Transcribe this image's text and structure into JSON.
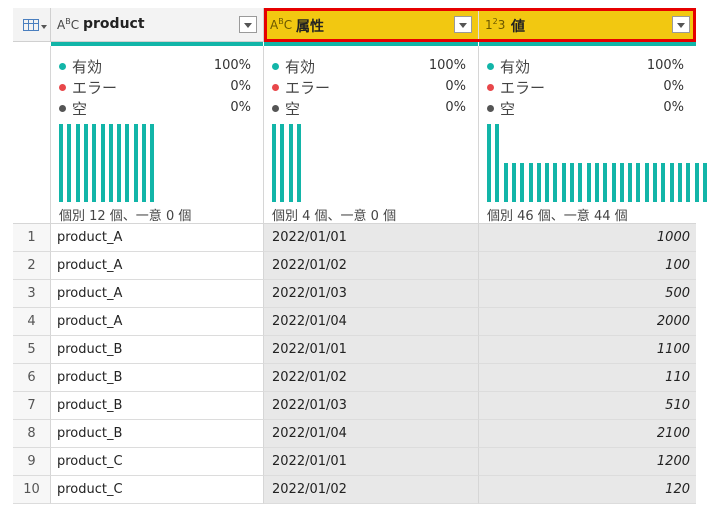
{
  "columns": [
    {
      "type_icon": "ABC",
      "name": "product",
      "selected": false
    },
    {
      "type_icon": "ABC",
      "name": "属性",
      "selected": true
    },
    {
      "type_icon": "123",
      "name": "値",
      "selected": true
    }
  ],
  "profile": [
    {
      "valid_label": "有効",
      "valid_pct": "100%",
      "error_label": "エラー",
      "error_pct": "0%",
      "empty_label": "空",
      "empty_pct": "0%",
      "distinct": "個別 12 個、一意 0 個",
      "distribution": [
        1,
        1,
        1,
        1,
        1,
        1,
        1,
        1,
        1,
        1,
        1,
        1
      ]
    },
    {
      "valid_label": "有効",
      "valid_pct": "100%",
      "error_label": "エラー",
      "error_pct": "0%",
      "empty_label": "空",
      "empty_pct": "0%",
      "distinct": "個別 4 個、一意 0 個",
      "distribution": [
        1,
        1,
        1,
        1
      ]
    },
    {
      "valid_label": "有効",
      "valid_pct": "100%",
      "error_label": "エラー",
      "error_pct": "0%",
      "empty_label": "空",
      "empty_pct": "0%",
      "distinct": "個別 46 個、一意 44 個",
      "distribution": [
        1,
        1,
        0.5,
        0.5,
        0.5,
        0.5,
        0.5,
        0.5,
        0.5,
        0.5,
        0.5,
        0.5,
        0.5,
        0.5,
        0.5,
        0.5,
        0.5,
        0.5,
        0.5,
        0.5,
        0.5,
        0.5,
        0.5,
        0.5,
        0.5,
        0.5,
        0.5,
        0.5
      ]
    }
  ],
  "colors": {
    "valid": "#12b5a8",
    "error": "#e8474a",
    "empty": "#555555",
    "selected_header": "#f2c811",
    "highlight_frame": "#e60000"
  },
  "rows": [
    {
      "n": "1",
      "product": "product_A",
      "attr": "2022/01/01",
      "value": "1000"
    },
    {
      "n": "2",
      "product": "product_A",
      "attr": "2022/01/02",
      "value": "100"
    },
    {
      "n": "3",
      "product": "product_A",
      "attr": "2022/01/03",
      "value": "500"
    },
    {
      "n": "4",
      "product": "product_A",
      "attr": "2022/01/04",
      "value": "2000"
    },
    {
      "n": "5",
      "product": "product_B",
      "attr": "2022/01/01",
      "value": "1100"
    },
    {
      "n": "6",
      "product": "product_B",
      "attr": "2022/01/02",
      "value": "110"
    },
    {
      "n": "7",
      "product": "product_B",
      "attr": "2022/01/03",
      "value": "510"
    },
    {
      "n": "8",
      "product": "product_B",
      "attr": "2022/01/04",
      "value": "2100"
    },
    {
      "n": "9",
      "product": "product_C",
      "attr": "2022/01/01",
      "value": "1200"
    },
    {
      "n": "10",
      "product": "product_C",
      "attr": "2022/01/02",
      "value": "120"
    }
  ]
}
